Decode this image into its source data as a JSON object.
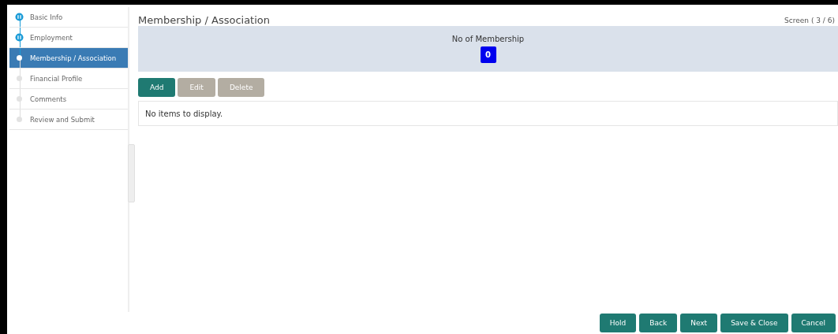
{
  "steps": [
    {
      "label": "Basic Info",
      "completed": true,
      "selected": false
    },
    {
      "label": "Employment",
      "completed": true,
      "selected": false
    },
    {
      "label": "Membership / Association",
      "completed": false,
      "selected": true
    },
    {
      "label": "Financial Profile",
      "completed": false,
      "selected": false
    },
    {
      "label": "Comments",
      "completed": false,
      "selected": false
    },
    {
      "label": "Review and Submit",
      "completed": false,
      "selected": false
    }
  ],
  "page_title": "Membership / Association",
  "screen_counter": "Screen ( 3 / 6)",
  "summary": {
    "label": "No of Membership",
    "count": "0"
  },
  "actions": [
    {
      "label": "Add",
      "disabled": false
    },
    {
      "label": "Edit",
      "disabled": true
    },
    {
      "label": "Delete",
      "disabled": true
    }
  ],
  "empty_message": "No items to display.",
  "footer_buttons": [
    "Hold",
    "Back",
    "Next",
    "Save & Close",
    "Cancel"
  ]
}
